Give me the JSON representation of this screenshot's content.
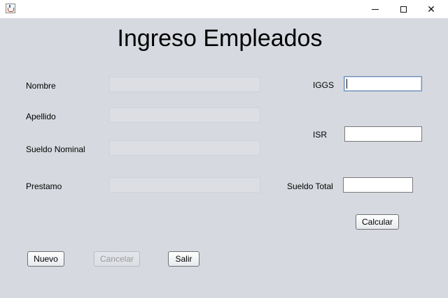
{
  "window": {
    "title": ""
  },
  "form": {
    "title": "Ingreso Empleados",
    "labels": {
      "nombre": "Nombre",
      "apellido": "Apellido",
      "sueldo_nominal": "Sueldo Nominal",
      "prestamo": "Prestamo",
      "iggs": "IGGS",
      "isr": "ISR",
      "sueldo_total": "Sueldo Total"
    },
    "values": {
      "nombre": "",
      "apellido": "",
      "sueldo_nominal": "",
      "prestamo": "",
      "iggs": "",
      "isr": "",
      "sueldo_total": ""
    }
  },
  "buttons": {
    "calcular": "Calcular",
    "nuevo": "Nuevo",
    "cancelar": "Cancelar",
    "salir": "Salir"
  },
  "icons": {
    "app": "java-cup-icon",
    "minimize": "minimize-icon",
    "maximize": "maximize-icon",
    "close": "close-icon"
  }
}
